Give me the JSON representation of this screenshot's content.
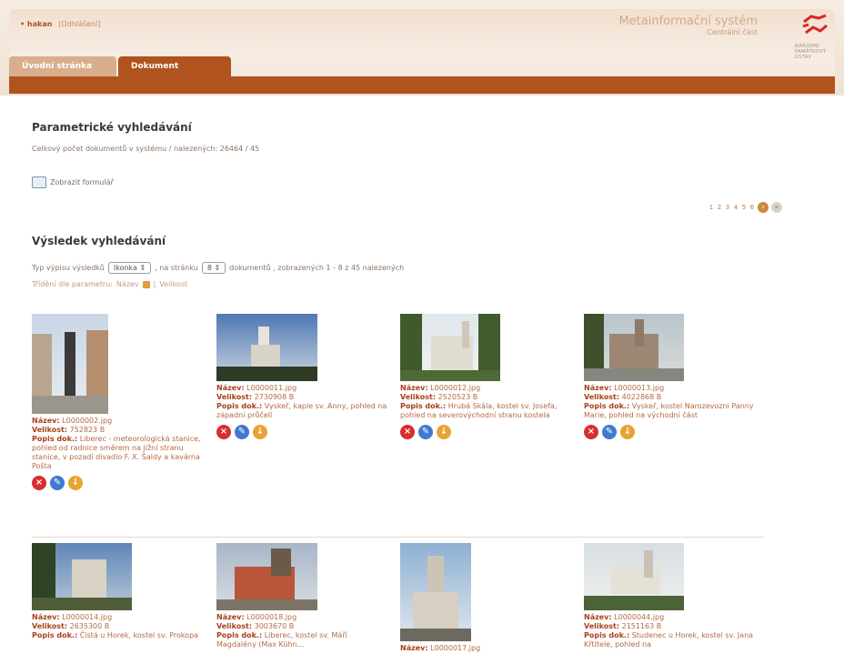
{
  "header": {
    "user_name": "• hakan",
    "logout": "[Odhlášení]",
    "system_title": "Metainformační systém",
    "system_subtitle": "Centrální část",
    "logo_text": "NÁRODNÍ PAMÁTKOVÝ ÚSTAV"
  },
  "tabs": [
    "Úvodní stránka",
    "Dokument"
  ],
  "param_heading": "Parametrické vyhledávání",
  "count_text": "Celkový počet dokumentů v systému / nalezených: 26464 / 45",
  "show_form": "Zobrazit formulář",
  "pager": {
    "pages": [
      "1",
      "2",
      "3",
      "4",
      "5",
      "6"
    ]
  },
  "result_heading": "Výsledek vyhledávání",
  "listing": {
    "prefix": "Typ výpisu výsledků",
    "type_value": "Ikonka",
    "mid": ", na stránku",
    "per_page": "8",
    "suffix": "dokumentů , zobrazených 1 - 8 z 45 nalezených"
  },
  "sort": {
    "prefix": "Třídění dle parametru:",
    "name": "Název",
    "size": "Velikost"
  },
  "labels": {
    "name": "Název:",
    "size": "Velikost:",
    "desc": "Popis dok.:"
  },
  "items": [
    {
      "name": "L0000002.jpg",
      "size": "752823 B",
      "desc": "Liberec - meteorologická stanice, pohled od radnice směrem na jižní stranu stanice, v pozadí divadlo F. X. Šaldy a kavárna Pošta"
    },
    {
      "name": "L0000011.jpg",
      "size": "2730908 B",
      "desc": "Vyskeř, kaple sv. Anny, pohled na západní průčelí"
    },
    {
      "name": "L0000012.jpg",
      "size": "2520523 B",
      "desc": "Hrubá Skála, kostel sv. Josefa, pohled na severovýchodní stranu kostela"
    },
    {
      "name": "L0000013.jpg",
      "size": "4022868 B",
      "desc": "Vyskeř, kostel Narozevozni Panny Marie, pohled na východní část"
    },
    {
      "name": "L0000014.jpg",
      "size": "2635300 B",
      "desc": "Čistá u Horek, kostel sv. Prokopa"
    },
    {
      "name": "L0000018.jpg",
      "size": "3003670 B",
      "desc": "Liberec, kostel sv. Máří Magdalény (Max Kühn..."
    },
    {
      "name": "L0000017.jpg",
      "size": "",
      "desc": ""
    },
    {
      "name": "L0000044.jpg",
      "size": "2151163 B",
      "desc": "Studenec u Horek, kostel sv. Jana Křtitele, pohled na"
    }
  ],
  "colors": {
    "accent": "#b1531f",
    "label": "#a9401c",
    "text": "#b26b44"
  }
}
